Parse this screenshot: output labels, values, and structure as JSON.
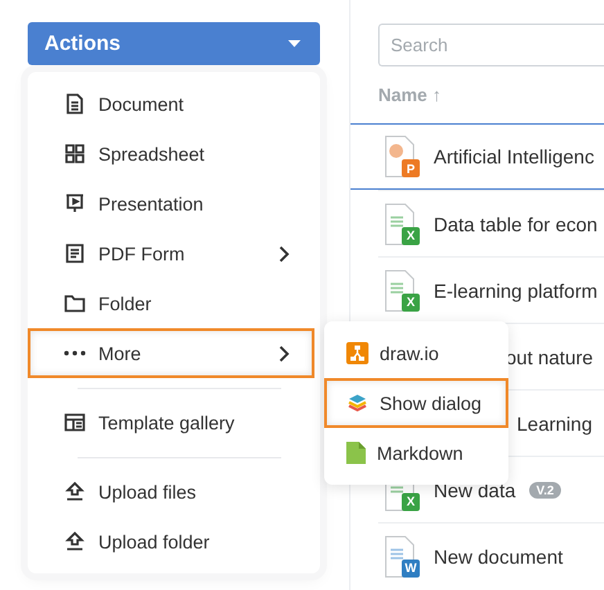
{
  "actions_button": {
    "label": "Actions"
  },
  "menu": {
    "items": [
      {
        "kind": "item",
        "label": "Document",
        "has_submenu": false,
        "highlighted": false
      },
      {
        "kind": "item",
        "label": "Spreadsheet",
        "has_submenu": false,
        "highlighted": false
      },
      {
        "kind": "item",
        "label": "Presentation",
        "has_submenu": false,
        "highlighted": false
      },
      {
        "kind": "item",
        "label": "PDF Form",
        "has_submenu": true,
        "highlighted": false
      },
      {
        "kind": "item",
        "label": "Folder",
        "has_submenu": false,
        "highlighted": false
      },
      {
        "kind": "item",
        "label": "More",
        "has_submenu": true,
        "highlighted": true
      },
      {
        "kind": "separator"
      },
      {
        "kind": "item",
        "label": "Template gallery",
        "has_submenu": false,
        "highlighted": false
      },
      {
        "kind": "separator"
      },
      {
        "kind": "item",
        "label": "Upload files",
        "has_submenu": false,
        "highlighted": false
      },
      {
        "kind": "item",
        "label": "Upload folder",
        "has_submenu": false,
        "highlighted": false
      }
    ]
  },
  "submenu": {
    "items": [
      {
        "label": "draw.io",
        "highlighted": false
      },
      {
        "label": "Show dialog",
        "highlighted": true
      },
      {
        "label": "Markdown",
        "highlighted": false
      }
    ]
  },
  "search": {
    "placeholder": "Search"
  },
  "table": {
    "sort_column": {
      "label": "Name",
      "arrow": "↑"
    },
    "rows": [
      {
        "kind": "presentation",
        "badge": "P",
        "name": "Artificial Intelligenc",
        "selected": true
      },
      {
        "kind": "spreadsheet",
        "badge": "X",
        "name": "Data table for econ",
        "selected": false
      },
      {
        "kind": "spreadsheet",
        "badge": "X",
        "name": "E-learning platform",
        "selected": false
      },
      {
        "name": "out nature",
        "selected": false
      },
      {
        "name": "Learning",
        "selected": false
      },
      {
        "kind": "spreadsheet",
        "badge": "X",
        "name": "New data",
        "version": "V.2",
        "selected": false
      },
      {
        "kind": "document",
        "badge": "W",
        "name": "New document",
        "selected": false
      }
    ]
  }
}
